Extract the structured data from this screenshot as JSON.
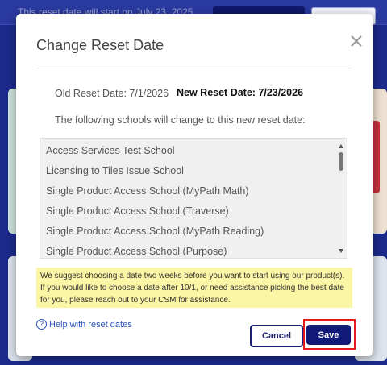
{
  "background": {
    "banner_text": "This reset date will start on July 23, 2025"
  },
  "modal": {
    "title": "Change Reset Date",
    "close_icon": "close-icon",
    "old_reset_date": "Old Reset Date: 7/1/2026",
    "new_reset_date": "New Reset Date: 7/23/2026",
    "intro_text": "The following schools will change to this new reset date:",
    "schools": [
      "Access Services Test School",
      "Licensing to Tiles Issue School",
      "Single Product Access School (MyPath Math)",
      "Single Product Access School (Traverse)",
      "Single Product Access School (MyPath Reading)",
      "Single Product Access School (Purpose)"
    ],
    "notice_lines": [
      "We suggest choosing a date two weeks before you want to start using our product(s).",
      "If you would like to choose a date after 10/1, or need assistance picking the best date",
      "for you, please reach out to your CSM for assistance."
    ],
    "help_link": "Help with reset dates",
    "cancel_label": "Cancel",
    "save_label": "Save"
  },
  "colors": {
    "primary": "#121a78",
    "notice_bg": "#fbf5a6",
    "highlight": "#e21b1b",
    "link": "#2a52be"
  }
}
